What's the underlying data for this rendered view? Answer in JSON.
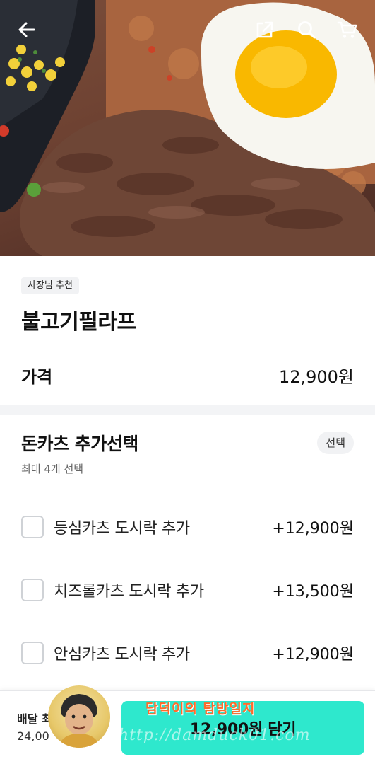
{
  "header": {
    "icons": [
      "back-arrow-icon",
      "share-icon",
      "search-icon",
      "cart-icon"
    ]
  },
  "product": {
    "badge": "사장님 추천",
    "name": "불고기필라프",
    "price_label": "가격",
    "price": "12,900원"
  },
  "options": {
    "title": "돈카츠 추가선택",
    "select_label": "선택",
    "subtitle": "최대 4개 선택",
    "items": [
      {
        "name": "등심카츠 도시락 추가",
        "price": "+12,900원"
      },
      {
        "name": "치즈롤카츠 도시락 추가",
        "price": "+13,500원"
      },
      {
        "name": "안심카츠 도시락 추가",
        "price": "+12,900원"
      }
    ]
  },
  "bottom_bar": {
    "min_order_label": "배달 최",
    "min_order_value": "24,00",
    "cart_button_label": "12,900원 담기",
    "accent_color": "#2ee8cd"
  },
  "watermark": {
    "title": "담덕이의 탐방일지",
    "url": "http://damduck01.com"
  }
}
